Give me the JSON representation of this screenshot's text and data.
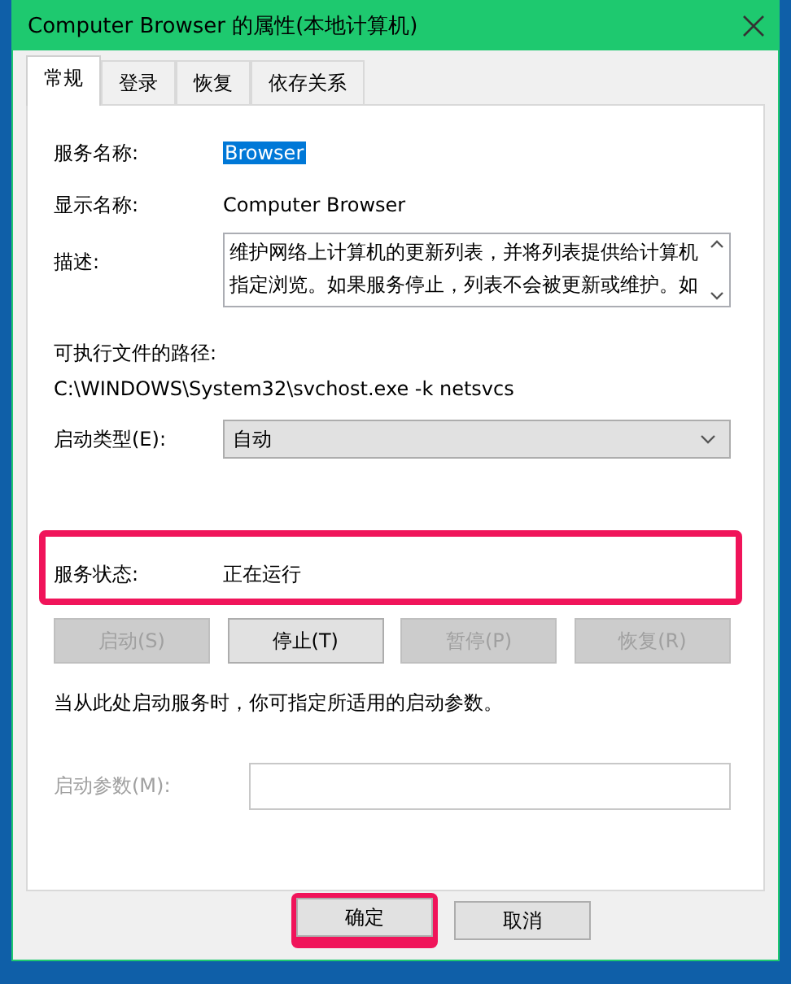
{
  "window": {
    "title": "Computer Browser 的属性(本地计算机)"
  },
  "tabs": [
    {
      "label": "常规",
      "selected": true
    },
    {
      "label": "登录",
      "selected": false
    },
    {
      "label": "恢复",
      "selected": false
    },
    {
      "label": "依存关系",
      "selected": false
    }
  ],
  "service_name": {
    "label": "服务名称:",
    "value": "Browser",
    "selected": true
  },
  "display_name": {
    "label": "显示名称:",
    "value": "Computer Browser"
  },
  "description": {
    "label": "描述:",
    "value": "维护网络上计算机的更新列表，并将列表提供给计算机指定浏览。如果服务停止，列表不会被更新或维护。如"
  },
  "executable_path": {
    "label": "可执行文件的路径:",
    "value": "C:\\WINDOWS\\System32\\svchost.exe -k netsvcs"
  },
  "startup_type": {
    "label": "启动类型(E):",
    "value": "自动"
  },
  "service_status": {
    "label": "服务状态:",
    "value": "正在运行",
    "highlighted": true
  },
  "service_buttons": [
    {
      "label": "启动(S)",
      "disabled": true
    },
    {
      "label": "停止(T)",
      "disabled": false
    },
    {
      "label": "暂停(P)",
      "disabled": true
    },
    {
      "label": "恢复(R)",
      "disabled": true
    }
  ],
  "hint": "当从此处启动服务时，你可指定所适用的启动参数。",
  "start_parameters": {
    "label": "启动参数(M):",
    "disabled": true
  },
  "dialog_buttons": [
    {
      "label": "确定",
      "highlighted": true,
      "disabled": false
    },
    {
      "label": "取消",
      "highlighted": false,
      "disabled": false
    }
  ]
}
